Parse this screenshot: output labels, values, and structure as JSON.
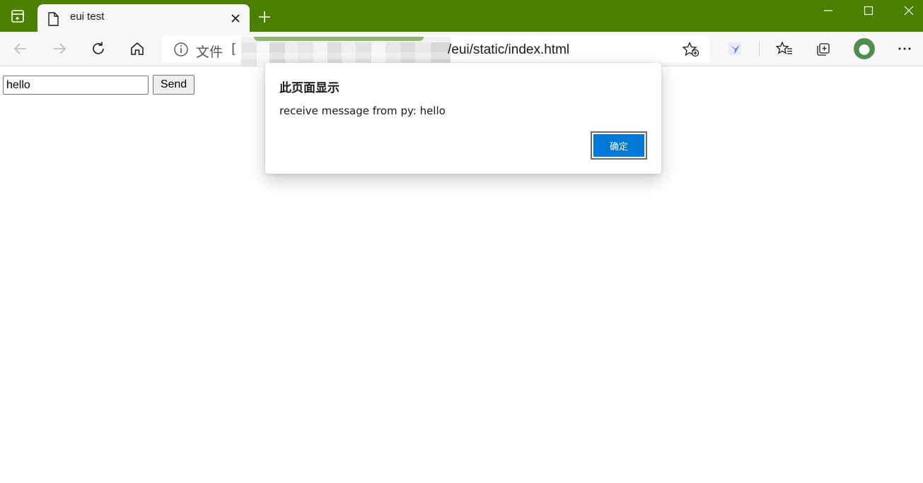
{
  "window": {
    "tab_title": "eui test",
    "accent_color": "#4a7f00"
  },
  "toolbar": {
    "address_scheme_label": "文件",
    "address_path": "/eui/static/index.html",
    "icons": [
      "back-icon",
      "forward-icon",
      "refresh-icon",
      "home-icon",
      "info-icon",
      "add-favorite-icon",
      "extension-icon",
      "favorites-icon",
      "collections-icon",
      "more-icon"
    ]
  },
  "page": {
    "message_input_value": "hello",
    "send_label": "Send"
  },
  "dialog": {
    "title": "此页面显示",
    "message": "receive message from py: hello",
    "ok_label": "确定",
    "button_color": "#0078d7"
  }
}
